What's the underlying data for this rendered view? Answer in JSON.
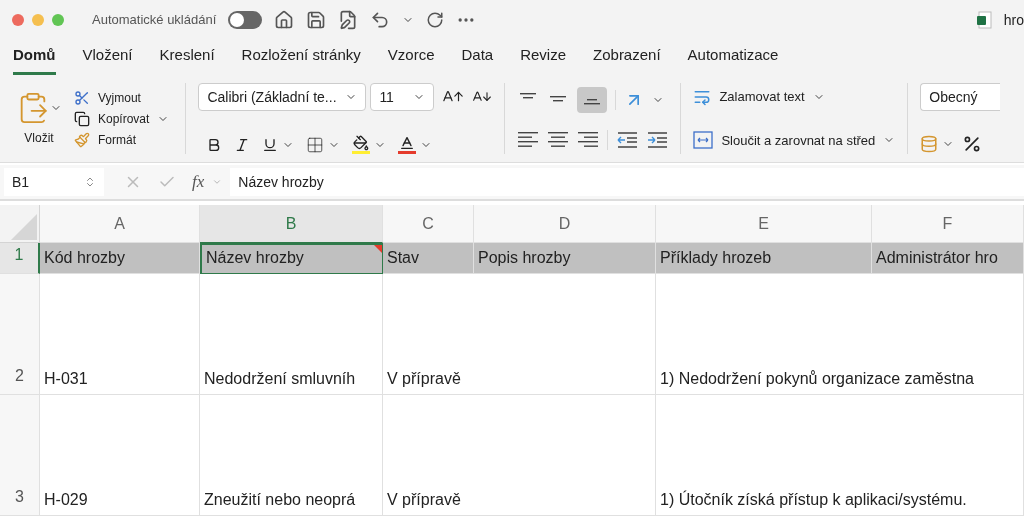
{
  "window": {
    "title": "hro",
    "autosave_label": "Automatické ukládání",
    "autosave_on": false
  },
  "tabs": [
    {
      "label": "Domů",
      "selected": true
    },
    {
      "label": "Vložení",
      "selected": false
    },
    {
      "label": "Kreslení",
      "selected": false
    },
    {
      "label": "Rozložení stránky",
      "selected": false
    },
    {
      "label": "Vzorce",
      "selected": false
    },
    {
      "label": "Data",
      "selected": false
    },
    {
      "label": "Revize",
      "selected": false
    },
    {
      "label": "Zobrazení",
      "selected": false
    },
    {
      "label": "Automatizace",
      "selected": false
    }
  ],
  "ribbon": {
    "paste": "Vložit",
    "cut": "Vyjmout",
    "copy": "Kopírovat",
    "format_painter": "Formát",
    "font": "Calibri (Základní te...",
    "font_size": "11",
    "wrap_text": "Zalamovat text",
    "merge": "Sloučit a zarovnat na střed",
    "number_format": "Obecný",
    "bottom_align_selected": true
  },
  "formula_bar": {
    "name_box": "B1",
    "fx": "fx",
    "value": "Název hrozby"
  },
  "columns": [
    "A",
    "B",
    "C",
    "D",
    "E",
    "F"
  ],
  "rows": [
    {
      "number": "1",
      "kind": "header",
      "cells": {
        "A": {
          "text": "Kód hrozby",
          "selected": false,
          "comment": false
        },
        "B": {
          "text": "Název hrozby",
          "selected": true,
          "comment": true
        },
        "C": {
          "text": "Stav",
          "selected": false,
          "comment": false
        },
        "D": {
          "text": "Popis hrozby",
          "selected": false,
          "comment": false
        },
        "E": {
          "text": "Příklady hrozeb",
          "selected": false,
          "comment": false
        },
        "F": {
          "text": "Administrátor hro",
          "selected": false,
          "comment": false
        }
      }
    },
    {
      "number": "2",
      "kind": "data",
      "cells": {
        "A": {
          "text": "H-031",
          "selected": false,
          "comment": false
        },
        "B": {
          "text": "Nedodržení smluvníh",
          "selected": false,
          "comment": false
        },
        "C": {
          "text": "V přípravě",
          "selected": false,
          "comment": false
        },
        "E": {
          "text": "1) Nedodržení pokynů organizace zaměstna",
          "selected": false,
          "comment": false
        }
      }
    },
    {
      "number": "3",
      "kind": "data",
      "cells": {
        "A": {
          "text": "H-029",
          "selected": false,
          "comment": false
        },
        "B": {
          "text": "Zneužití nebo neoprá",
          "selected": false,
          "comment": false
        },
        "C": {
          "text": "V přípravě",
          "selected": false,
          "comment": false
        },
        "E": {
          "text": "1) Útočník získá přístup k aplikaci/systému.",
          "selected": false,
          "comment": false
        }
      }
    }
  ]
}
